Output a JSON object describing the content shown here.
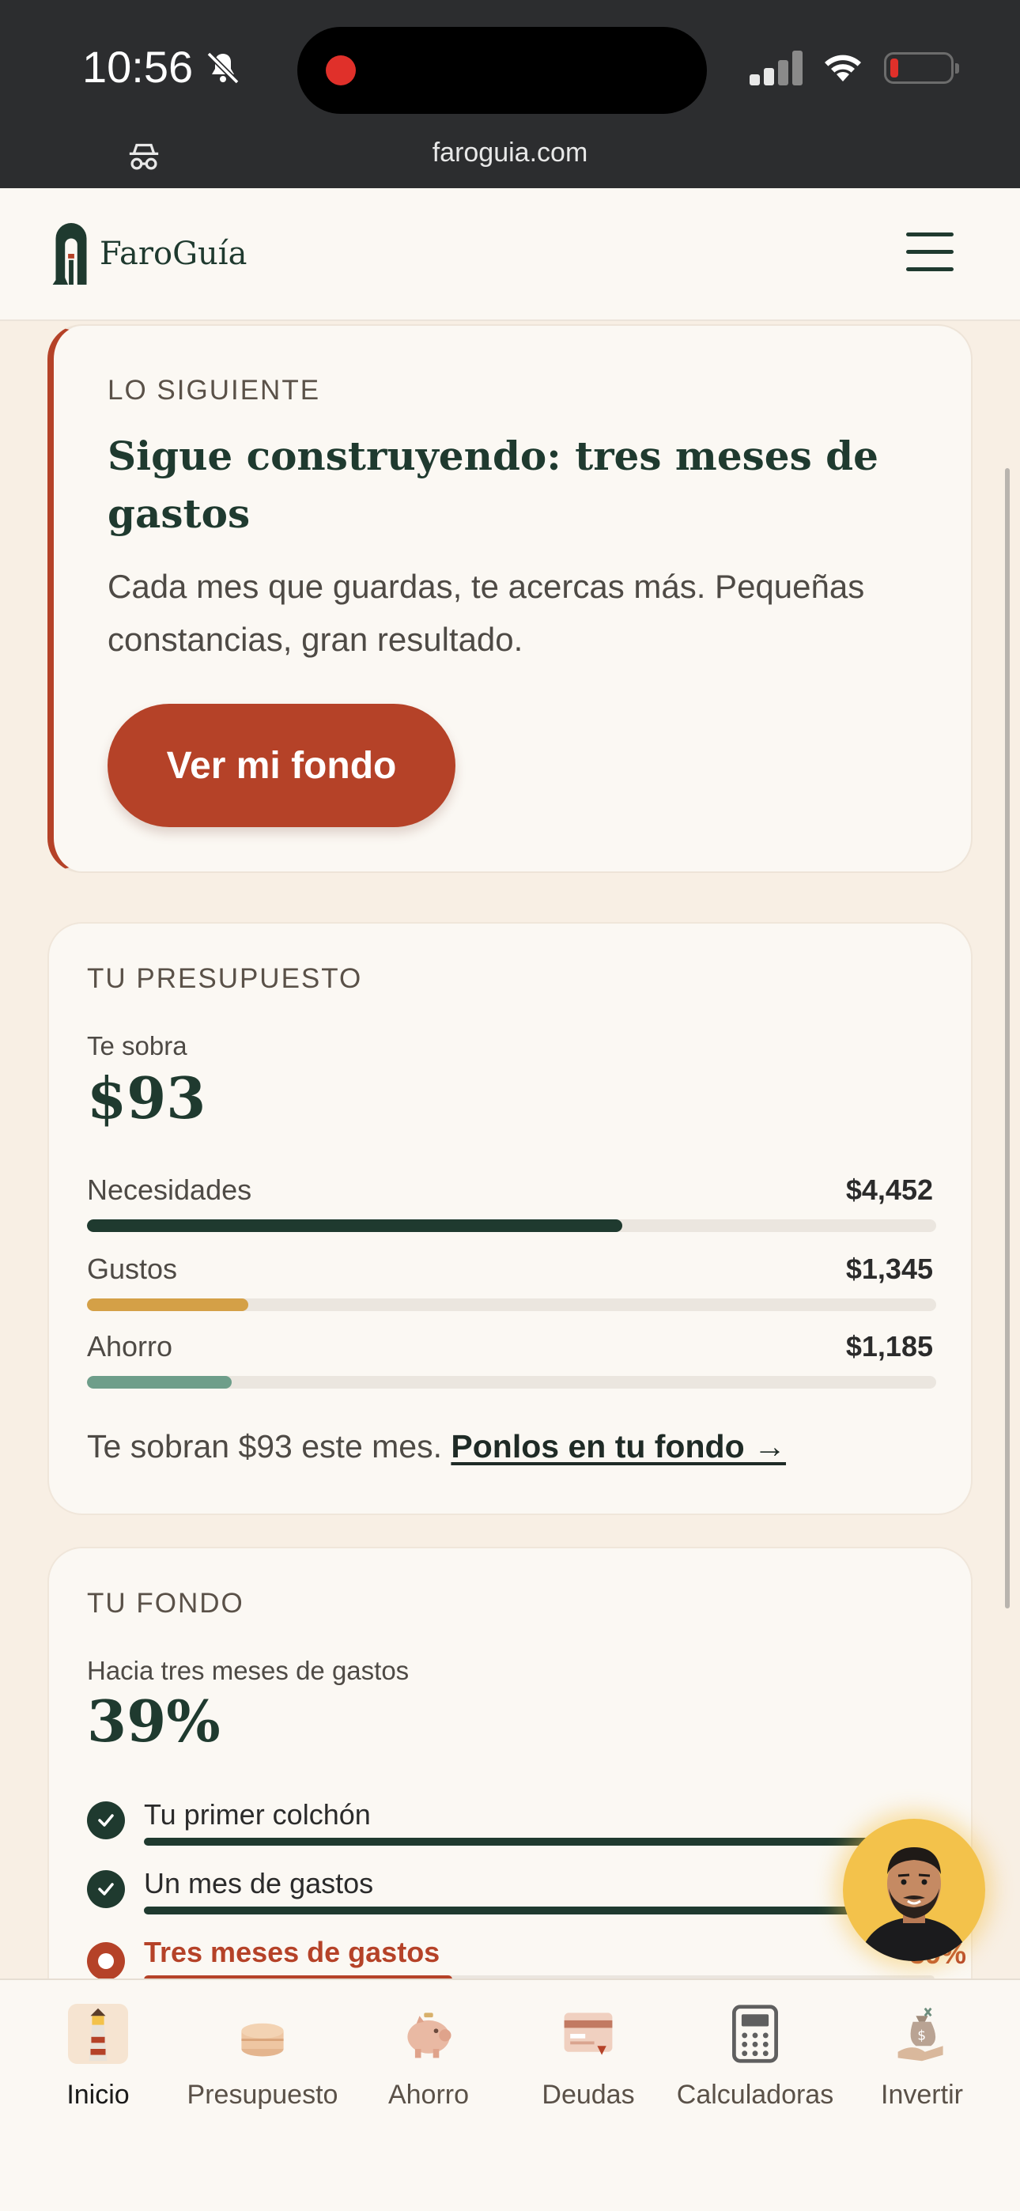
{
  "status_bar": {
    "time": "10:56"
  },
  "browser": {
    "url": "faroguia.com"
  },
  "header": {
    "brand": "FaroGuía"
  },
  "next": {
    "eyebrow": "LO SIGUIENTE",
    "title": "Sigue construyendo: tres meses de gastos",
    "body": "Cada mes que guardas, te acercas más. Pequeñas constancias, gran resultado.",
    "cta": "Ver mi fondo"
  },
  "budget": {
    "eyebrow": "TU PRESUPUESTO",
    "left_label": "Te sobra",
    "left_value": "$93",
    "rows": [
      {
        "label": "Necesidades",
        "value": "$4,452",
        "fraction": 0.63,
        "color": "#1f3a2f"
      },
      {
        "label": "Gustos",
        "value": "$1,345",
        "fraction": 0.19,
        "color": "#d4a047"
      },
      {
        "label": "Ahorro",
        "value": "$1,185",
        "fraction": 0.17,
        "color": "#6e9e8a"
      }
    ],
    "note": "Te sobran $93 este mes.",
    "link": "Ponlos en tu fondo →"
  },
  "fund": {
    "eyebrow": "TU FONDO",
    "subtitle": "Hacia tres meses de gastos",
    "percent": "39%",
    "milestones": [
      {
        "label": "Tu primer colchón",
        "status": "done"
      },
      {
        "label": "Un mes de gastos",
        "status": "done"
      },
      {
        "label": "Tres meses de gastos",
        "status": "current",
        "percent_text": "39%",
        "progress": 0.39
      }
    ]
  },
  "bottom_nav": {
    "items": [
      {
        "label": "Inicio",
        "icon": "lighthouse-icon",
        "active": true
      },
      {
        "label": "Presupuesto",
        "icon": "coins-icon",
        "active": false
      },
      {
        "label": "Ahorro",
        "icon": "piggy-bank-icon",
        "active": false
      },
      {
        "label": "Deudas",
        "icon": "credit-card-icon",
        "active": false
      },
      {
        "label": "Calculadoras",
        "icon": "calculator-icon",
        "active": false
      },
      {
        "label": "Invertir",
        "icon": "money-bag-icon",
        "active": false
      }
    ]
  },
  "colors": {
    "accent": "#b54228",
    "primary": "#1f3a2f",
    "background": "#f8efe4"
  }
}
